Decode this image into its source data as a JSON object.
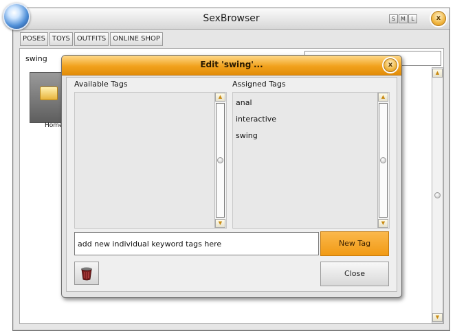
{
  "app": {
    "title": "SexBrowser",
    "size_buttons": [
      "S",
      "M",
      "L"
    ],
    "close_glyph": "x"
  },
  "menu": {
    "tabs": [
      "POSES",
      "TOYS",
      "OUTFITS",
      "ONLINE SHOP"
    ]
  },
  "browser": {
    "path": "swing",
    "search_value": "",
    "folder_label": "Home"
  },
  "dialog": {
    "title": "Edit 'swing'...",
    "close_glyph": "x",
    "available_header": "Available Tags",
    "assigned_header": "Assigned Tags",
    "available_tags": [],
    "assigned_tags": [
      "anal",
      "interactive",
      "swing"
    ],
    "input_value": "add new individual keyword tags here",
    "new_tag_label": "New Tag",
    "close_label": "Close"
  },
  "colors": {
    "accent": "#f19a14",
    "title_bar": "#e6e6e6"
  },
  "icons": {
    "logo": "globe-logo-icon",
    "folder": "folder-icon",
    "trash": "trash-icon",
    "scroll_up": "arrow-up-icon",
    "scroll_down": "arrow-down-icon"
  }
}
